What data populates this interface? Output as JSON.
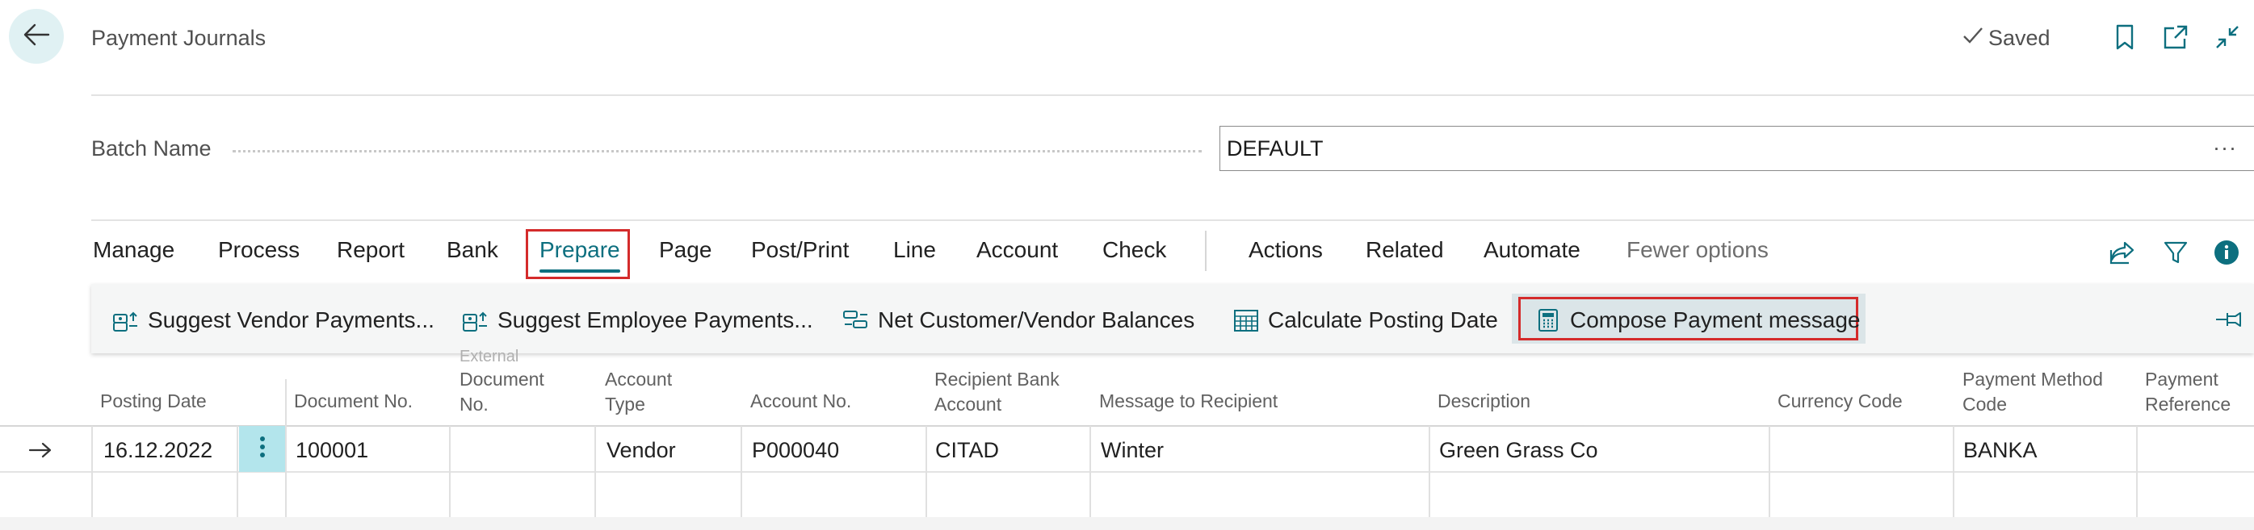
{
  "header": {
    "title": "Payment Journals",
    "saved_label": "Saved",
    "icons": [
      "back-arrow-icon",
      "checkmark-icon",
      "bookmark-icon",
      "open-new-window-icon",
      "collapse-icon"
    ]
  },
  "batch": {
    "label": "Batch Name",
    "value": "DEFAULT",
    "ellipsis": "···"
  },
  "menu": {
    "items": [
      "Manage",
      "Process",
      "Report",
      "Bank",
      "Prepare",
      "Page",
      "Post/Print",
      "Line",
      "Account",
      "Check"
    ],
    "items2": [
      "Actions",
      "Related",
      "Automate"
    ],
    "fewer_options": "Fewer options",
    "active": "Prepare",
    "right_icons": [
      "share-icon",
      "filter-icon",
      "info-icon"
    ]
  },
  "actions": {
    "items": [
      {
        "label": "Suggest Vendor Payments...",
        "icon": "suggest-payments-icon"
      },
      {
        "label": "Suggest Employee Payments...",
        "icon": "suggest-payments-icon"
      },
      {
        "label": "Net Customer/Vendor Balances",
        "icon": "net-balances-icon"
      },
      {
        "label": "Calculate Posting Date",
        "icon": "calendar-icon"
      },
      {
        "label": "Compose Payment message",
        "icon": "calculator-icon"
      }
    ],
    "pin_icon": "pin-icon"
  },
  "grid": {
    "columns": {
      "posting_date": "Posting Date",
      "document_no": "Document No.",
      "external_doc_line1": "External",
      "external_doc_line2": "Document",
      "external_doc_line3": "No.",
      "account_type_line1": "Account",
      "account_type_line2": "Type",
      "account_no": "Account No.",
      "recipient_bank_line1": "Recipient Bank",
      "recipient_bank_line2": "Account",
      "message": "Message to Recipient",
      "description": "Description",
      "currency": "Currency Code",
      "payment_method_line1": "Payment Method",
      "payment_method_line2": "Code",
      "payment_ref_line1": "Payment",
      "payment_ref_line2": "Reference"
    },
    "rows": [
      {
        "posting_date": "16.12.2022",
        "document_no": "100001",
        "external_doc": "",
        "account_type": "Vendor",
        "account_no": "P000040",
        "recipient_bank": "CITAD",
        "message": "Winter",
        "description": "Green Grass Co",
        "currency": "",
        "payment_method": "BANKA",
        "payment_ref": ""
      }
    ]
  },
  "colors": {
    "accent": "#0d6f7f",
    "highlight_border": "#d42b2b",
    "back_button_bg": "#e0f1f3",
    "row_menu_bg": "#b3e5ec"
  }
}
